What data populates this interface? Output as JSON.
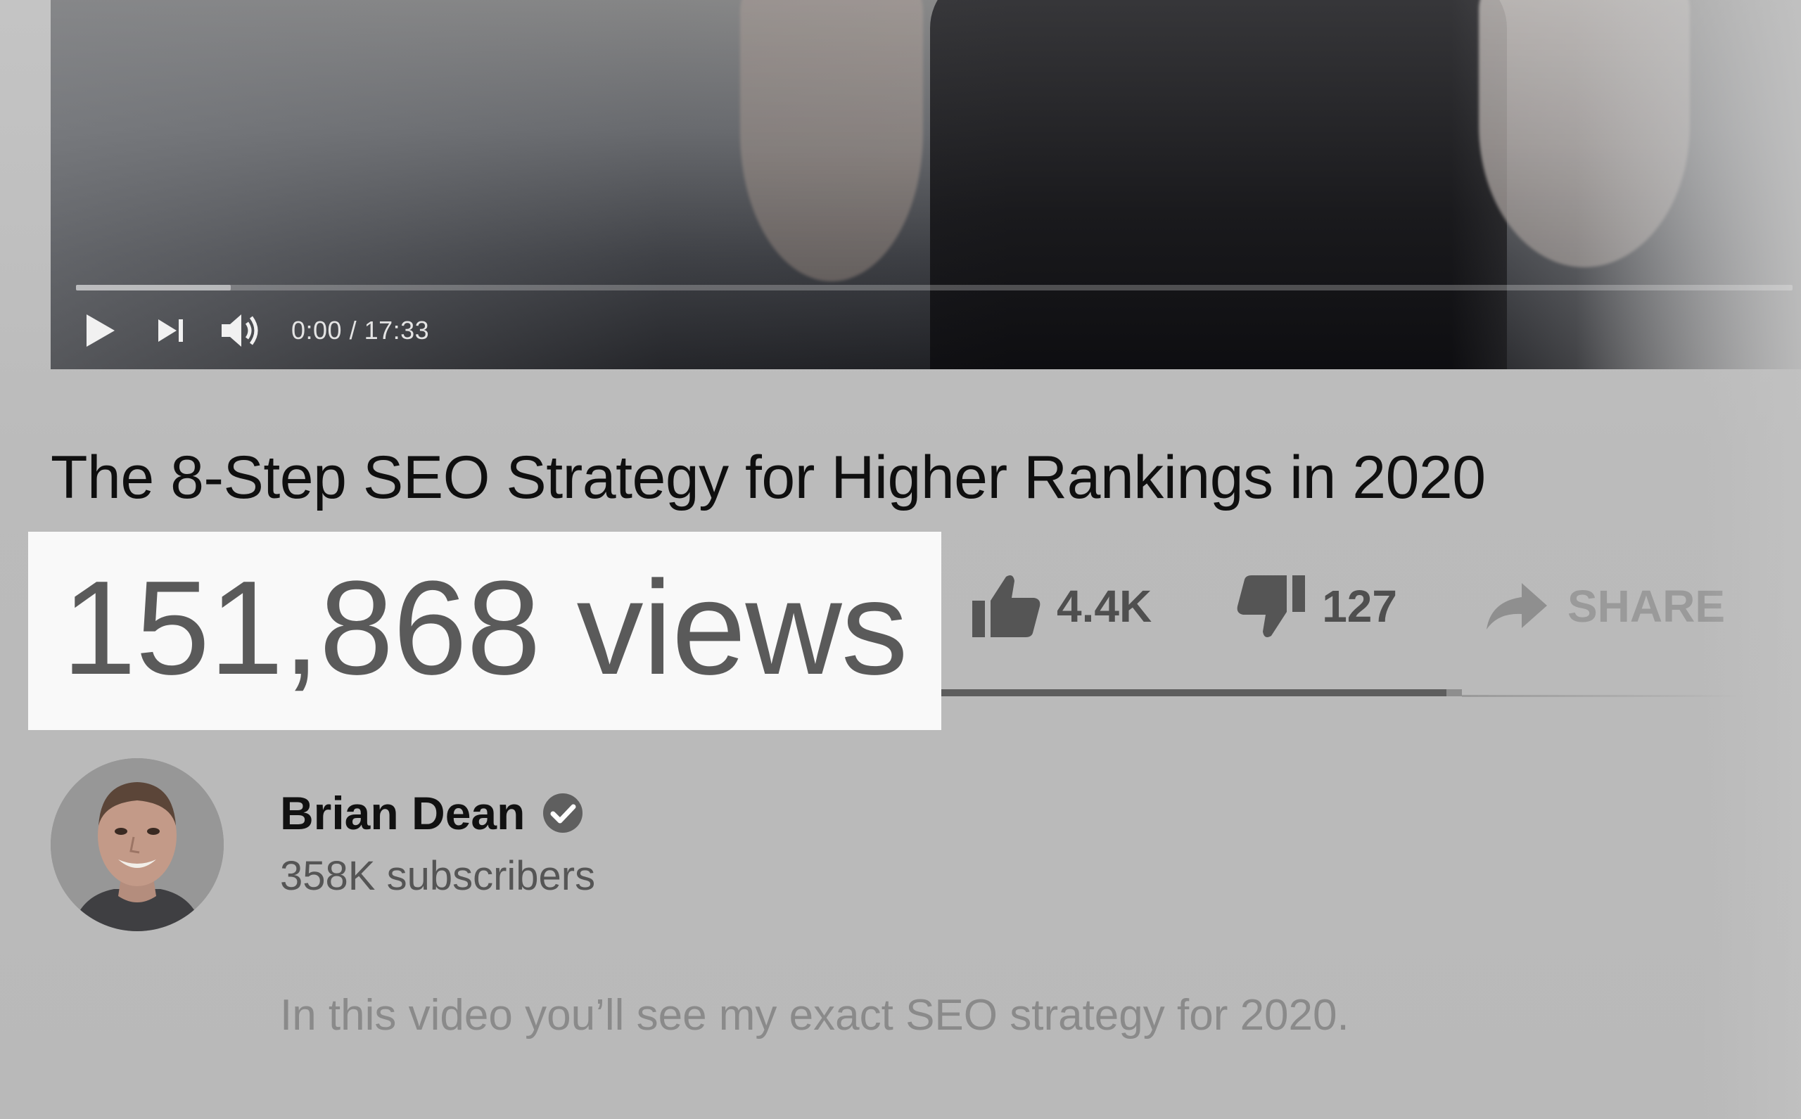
{
  "player": {
    "time_display": "0:00 / 17:33",
    "loaded_fraction": 0.09,
    "controls": {
      "play_icon": "play-icon",
      "next_icon": "skip-next-icon",
      "volume_icon": "volume-icon"
    }
  },
  "video": {
    "title": "The 8-Step SEO Strategy for Higher Rankings in 2020",
    "views": "151,868 views"
  },
  "actions": {
    "like_label": "4.4K",
    "dislike_label": "127",
    "share_label": "SHARE",
    "like_fraction": 0.97
  },
  "channel": {
    "name": "Brian Dean",
    "subscribers": "358K subscribers",
    "verified_icon": "verified-check-icon"
  },
  "description": "In this video you’ll see my exact SEO strategy for 2020.",
  "colors": {
    "highlight_bg": "#f9f9f9",
    "text_primary": "#0f0f0f",
    "text_muted": "#5a5a5a",
    "overlay_bg": "#bdbdbd"
  }
}
